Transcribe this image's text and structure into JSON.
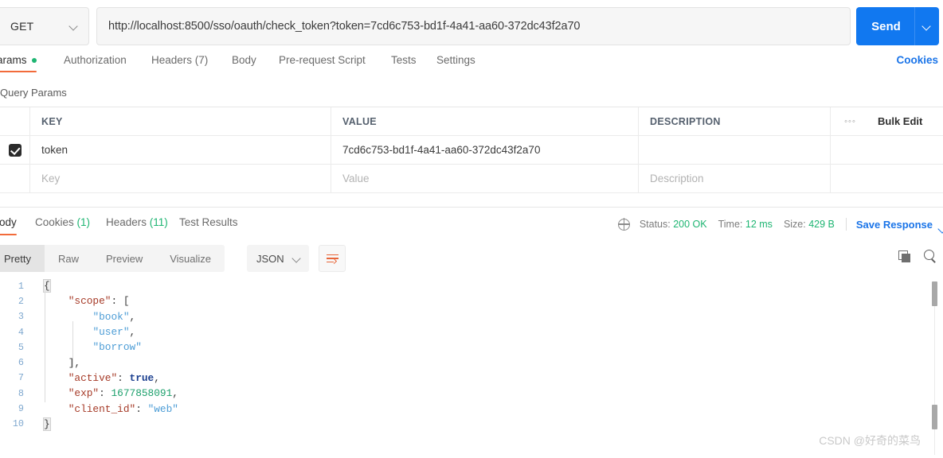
{
  "request": {
    "method": "GET",
    "url": "http://localhost:8500/sso/oauth/check_token?token=7cd6c753-bd1f-4a41-aa60-372dc43f2a70",
    "send_label": "Send",
    "tabs": [
      {
        "label": "Params",
        "active": true,
        "dot": true
      },
      {
        "label": "Authorization",
        "active": false
      },
      {
        "label": "Headers (7)",
        "active": false
      },
      {
        "label": "Body",
        "active": false
      },
      {
        "label": "Pre-request Script",
        "active": false
      },
      {
        "label": "Tests",
        "active": false
      },
      {
        "label": "Settings",
        "active": false
      }
    ],
    "cookies_link": "Cookies"
  },
  "query_params": {
    "title": "Query Params",
    "columns": [
      "KEY",
      "VALUE",
      "DESCRIPTION"
    ],
    "more_label": "◦◦◦",
    "bulk_edit_label": "Bulk Edit",
    "rows": [
      {
        "checked": true,
        "key": "token",
        "value": "7cd6c753-bd1f-4a41-aa60-372dc43f2a70",
        "description": ""
      }
    ],
    "placeholders": {
      "key": "Key",
      "value": "Value",
      "description": "Description"
    }
  },
  "response": {
    "tabs": [
      {
        "label": "Body",
        "count": "",
        "active": true
      },
      {
        "label": "Cookies",
        "count": "(1)",
        "active": false
      },
      {
        "label": "Headers",
        "count": "(11)",
        "active": false
      },
      {
        "label": "Test Results",
        "count": "",
        "active": false
      }
    ],
    "status": {
      "label": "Status:",
      "value": "200 OK"
    },
    "time": {
      "label": "Time:",
      "value": "12 ms"
    },
    "size": {
      "label": "Size:",
      "value": "429 B"
    },
    "save_response_label": "Save Response",
    "view_modes": [
      {
        "label": "Pretty",
        "selected": true
      },
      {
        "label": "Raw",
        "selected": false
      },
      {
        "label": "Preview",
        "selected": false
      },
      {
        "label": "Visualize",
        "selected": false
      }
    ],
    "format": "JSON",
    "body_lines": [
      {
        "n": "1",
        "segs": [
          {
            "t": "{",
            "c": "brace-hl p"
          }
        ]
      },
      {
        "n": "2",
        "segs": [
          {
            "t": "    ",
            "c": "p"
          },
          {
            "t": "\"scope\"",
            "c": "k"
          },
          {
            "t": ": ",
            "c": "p"
          },
          {
            "t": "[",
            "c": "p"
          }
        ]
      },
      {
        "n": "3",
        "segs": [
          {
            "t": "        ",
            "c": "p"
          },
          {
            "t": "\"book\"",
            "c": "s"
          },
          {
            "t": ",",
            "c": "p"
          }
        ]
      },
      {
        "n": "4",
        "segs": [
          {
            "t": "        ",
            "c": "p"
          },
          {
            "t": "\"user\"",
            "c": "s"
          },
          {
            "t": ",",
            "c": "p"
          }
        ]
      },
      {
        "n": "5",
        "segs": [
          {
            "t": "        ",
            "c": "p"
          },
          {
            "t": "\"borrow\"",
            "c": "s"
          }
        ]
      },
      {
        "n": "6",
        "segs": [
          {
            "t": "    ",
            "c": "p"
          },
          {
            "t": "],",
            "c": "p"
          }
        ]
      },
      {
        "n": "7",
        "segs": [
          {
            "t": "    ",
            "c": "p"
          },
          {
            "t": "\"active\"",
            "c": "k"
          },
          {
            "t": ": ",
            "c": "p"
          },
          {
            "t": "true",
            "c": "b"
          },
          {
            "t": ",",
            "c": "p"
          }
        ]
      },
      {
        "n": "8",
        "segs": [
          {
            "t": "    ",
            "c": "p"
          },
          {
            "t": "\"exp\"",
            "c": "k"
          },
          {
            "t": ": ",
            "c": "p"
          },
          {
            "t": "1677858091",
            "c": "n"
          },
          {
            "t": ",",
            "c": "p"
          }
        ]
      },
      {
        "n": "9",
        "segs": [
          {
            "t": "    ",
            "c": "p"
          },
          {
            "t": "\"client_id\"",
            "c": "k"
          },
          {
            "t": ": ",
            "c": "p"
          },
          {
            "t": "\"web\"",
            "c": "s"
          }
        ]
      },
      {
        "n": "10",
        "segs": [
          {
            "t": "}",
            "c": "brace-hl p"
          }
        ]
      }
    ],
    "json_data": {
      "scope": [
        "book",
        "user",
        "borrow"
      ],
      "active": true,
      "exp": 1677858091,
      "client_id": "web"
    }
  },
  "watermark": "CSDN @好奇的菜鸟",
  "colors": {
    "accent_blue": "#1178f0",
    "link_blue": "#1a74e8",
    "active_underline": "#f26b3a",
    "success_green": "#1eb572",
    "json_key": "#a63b28",
    "json_string": "#4d9dd6",
    "json_number": "#1ca06c",
    "json_bool": "#1b3f8f"
  }
}
